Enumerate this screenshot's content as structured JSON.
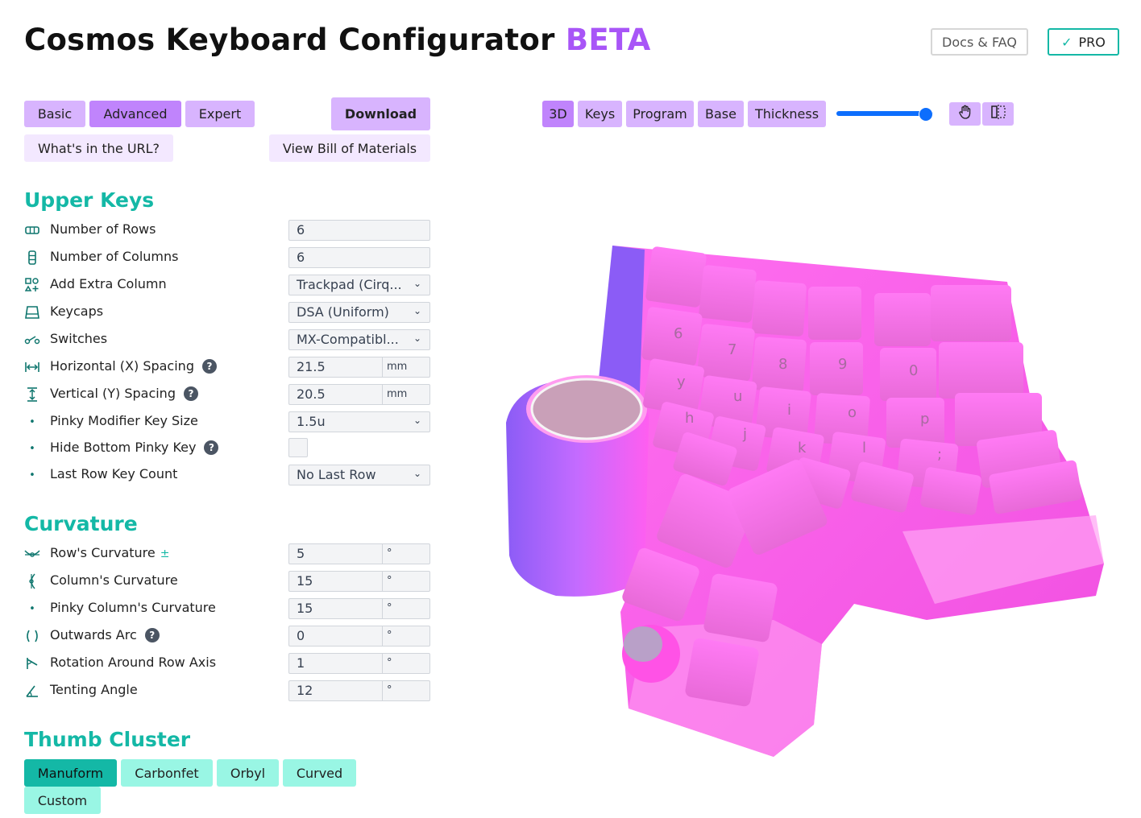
{
  "header": {
    "title": "Cosmos Keyboard Configurator",
    "badge": "BETA",
    "docs_label": "Docs & FAQ",
    "pro_label": "PRO"
  },
  "modes": {
    "basic": "Basic",
    "advanced": "Advanced",
    "expert": "Expert",
    "active": "Advanced"
  },
  "actions": {
    "download": "Download",
    "whats_url": "What's in the URL?",
    "bom": "View Bill of Materials"
  },
  "view_tabs": {
    "three_d": "3D",
    "keys": "Keys",
    "program": "Program",
    "base": "Base",
    "thickness": "Thickness",
    "active": "3D",
    "opacity_level": 0.92
  },
  "upper_keys": {
    "heading": "Upper Keys",
    "rows": {
      "label": "Number of Rows",
      "value": "6"
    },
    "columns": {
      "label": "Number of Columns",
      "value": "6"
    },
    "extra_column": {
      "label": "Add Extra Column",
      "value": "Trackpad (Cirq..."
    },
    "keycaps": {
      "label": "Keycaps",
      "value": "DSA (Uniform)"
    },
    "switches": {
      "label": "Switches",
      "value": "MX-Compatibl..."
    },
    "h_spacing": {
      "label": "Horizontal (X) Spacing",
      "value": "21.5",
      "unit": "mm"
    },
    "v_spacing": {
      "label": "Vertical (Y) Spacing",
      "value": "20.5",
      "unit": "mm"
    },
    "pinky_mod": {
      "label": "Pinky Modifier Key Size",
      "value": "1.5u"
    },
    "hide_pinky": {
      "label": "Hide Bottom Pinky Key",
      "checked": false
    },
    "last_row": {
      "label": "Last Row Key Count",
      "value": "No Last Row"
    }
  },
  "curvature": {
    "heading": "Curvature",
    "row": {
      "label": "Row's Curvature",
      "value": "5",
      "unit": "°",
      "extra": "±"
    },
    "column": {
      "label": "Column's Curvature",
      "value": "15",
      "unit": "°"
    },
    "pinky_column": {
      "label": "Pinky Column's Curvature",
      "value": "15",
      "unit": "°"
    },
    "outwards_arc": {
      "label": "Outwards Arc",
      "value": "0",
      "unit": "°"
    },
    "row_axis": {
      "label": "Rotation Around Row Axis",
      "value": "1",
      "unit": "°"
    },
    "tenting": {
      "label": "Tenting Angle",
      "value": "12",
      "unit": "°"
    }
  },
  "thumb_cluster": {
    "heading": "Thumb Cluster",
    "options": [
      "Manuform",
      "Carbonfet",
      "Orbyl",
      "Curved",
      "Custom"
    ],
    "active": "Manuform"
  },
  "keycap_legends": [
    "6",
    "7",
    "8",
    "9",
    "0",
    "y",
    "u",
    "i",
    "o",
    "p",
    "h",
    "j",
    "k",
    "l",
    ";"
  ],
  "colors": {
    "accent_teal": "#14b8a6",
    "accent_purple": "#a855f7",
    "model_pink": "#ff5ee8",
    "model_violet": "#8b5cf6"
  }
}
